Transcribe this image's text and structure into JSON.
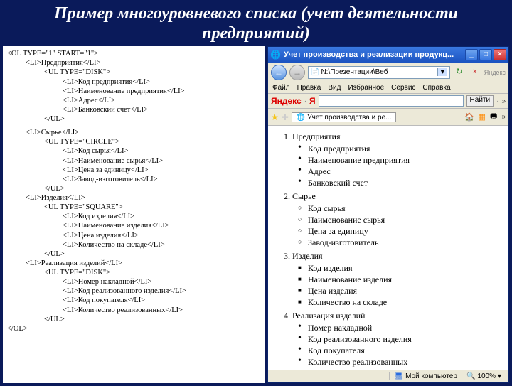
{
  "title": "Пример многоуровневого списка (учет деятельности предприятий)",
  "code": {
    "l0": "<OL TYPE=\"1\" START=\"1\">",
    "g1_li": "<LI>Предприятия</LI>",
    "g1_ul": "<UL TYPE=\"DISK\">",
    "g1_1": "<LI>Код предприятия</LI>",
    "g1_2": "<LI>Наименование предприятия</LI>",
    "g1_3": "<LI>Адрес</LI>",
    "g1_4": "<LI>Банковский счет</LI>",
    "g1_cl": "</UL>",
    "g2_li": "<LI>Сырье</LI>",
    "g2_ul": "<UL TYPE=\"CIRCLE\">",
    "g2_1": "<LI>Код сырья</LI>",
    "g2_2": "<LI>Наименование сырья</LI>",
    "g2_3": "<LI>Цена за единицу</LI>",
    "g2_4": "<LI>Завод-изготовитель</LI>",
    "g2_cl": "</UL>",
    "g3_li": "<LI>Изделия</LI>",
    "g3_ul": "<UL TYPE=\"SQUARE\">",
    "g3_1": "<LI>Код изделия</LI>",
    "g3_2": "<LI>Наименование изделия</LI>",
    "g3_3": "<LI>Цена изделия</LI>",
    "g3_4": "<LI>Количество на складе</LI>",
    "g3_cl": "</UL>",
    "g4_li": "<LI>Реализация изделий</LI>",
    "g4_ul": "<UL TYPE=\"DISK\">",
    "g4_1": "<LI>Номер накладной</LI>",
    "g4_2": "<LI>Код реализованного изделия</LI>",
    "g4_3": "<LI>Код покупателя</LI>",
    "g4_4": "<LI>Количество реализованных</LI>",
    "g4_cl": "</UL>",
    "end": "</OL>"
  },
  "browser": {
    "window_title": "Учет производства и реализации продукц...",
    "address": "N:\\Презентации\\Веб",
    "search_placeholder": "Яндекс",
    "menu": {
      "file": "Файл",
      "edit": "Правка",
      "view": "Вид",
      "fav": "Избранное",
      "tools": "Сервис",
      "help": "Справка"
    },
    "yandex": {
      "logo": "Яндекс",
      "ya": "Я",
      "search_btn": "Найти"
    },
    "tab_title": "Учет производства и ре...",
    "status": {
      "zone": "Мой компьютер",
      "zoom": "100%"
    }
  },
  "page": {
    "items": [
      {
        "title": "Предприятия",
        "type": "disk",
        "sub": [
          "Код предприятия",
          "Наименование предприятия",
          "Адрес",
          "Банковский счет"
        ]
      },
      {
        "title": "Сырье",
        "type": "circ",
        "sub": [
          "Код сырья",
          "Наименование сырья",
          "Цена за единицу",
          "Завод-изготовитель"
        ]
      },
      {
        "title": "Изделия",
        "type": "sq",
        "sub": [
          "Код изделия",
          "Наименование изделия",
          "Цена изделия",
          "Количество на складе"
        ]
      },
      {
        "title": "Реализация изделий",
        "type": "disk",
        "sub": [
          "Номер накладной",
          "Код реализованного изделия",
          "Код покупателя",
          "Количество реализованных"
        ]
      }
    ]
  }
}
